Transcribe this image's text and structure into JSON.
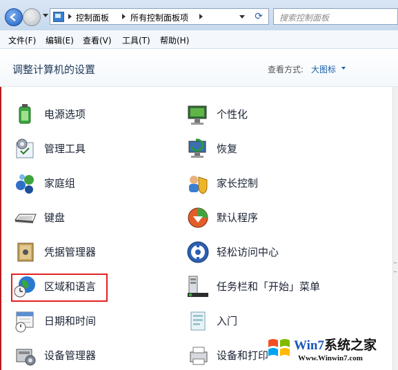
{
  "window": {
    "breadcrumbs": [
      "控制面板",
      "所有控制面板项"
    ],
    "search_placeholder": "搜索控制面板",
    "menu": [
      "文件(F)",
      "编辑(E)",
      "查看(V)",
      "工具(T)",
      "帮助(H)"
    ]
  },
  "header": {
    "title": "调整计算机的设置",
    "view_by_label": "查看方式:",
    "view_by_value": "大图标"
  },
  "items": [
    {
      "label": "电源选项",
      "icon": "power-options-icon"
    },
    {
      "label": "个性化",
      "icon": "personalization-icon"
    },
    {
      "label": "管理工具",
      "icon": "admin-tools-icon"
    },
    {
      "label": "恢复",
      "icon": "recovery-icon"
    },
    {
      "label": "家庭组",
      "icon": "homegroup-icon"
    },
    {
      "label": "家长控制",
      "icon": "parental-controls-icon"
    },
    {
      "label": "键盘",
      "icon": "keyboard-icon"
    },
    {
      "label": "默认程序",
      "icon": "default-programs-icon"
    },
    {
      "label": "凭据管理器",
      "icon": "credential-manager-icon"
    },
    {
      "label": "轻松访问中心",
      "icon": "ease-of-access-icon"
    },
    {
      "label": "区域和语言",
      "icon": "region-language-icon",
      "highlighted": true
    },
    {
      "label": "任务栏和「开始」菜单",
      "icon": "taskbar-start-menu-icon"
    },
    {
      "label": "日期和时间",
      "icon": "date-time-icon"
    },
    {
      "label": "入门",
      "icon": "getting-started-icon"
    },
    {
      "label": "设备管理器",
      "icon": "device-manager-icon"
    },
    {
      "label": "设备和打印",
      "icon": "devices-printers-icon"
    }
  ],
  "watermark": {
    "brand_a": "Win7",
    "brand_b": "系统之家",
    "url": "Www.Winwin7.com"
  },
  "colors": {
    "highlight_border": "#e02020",
    "link_blue": "#1a5ea8",
    "title_blue": "#1e395b"
  }
}
